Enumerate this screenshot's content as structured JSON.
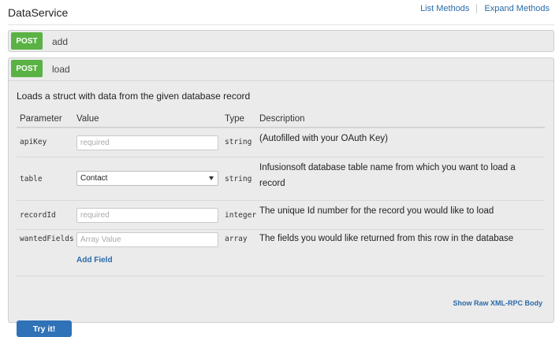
{
  "service": {
    "title": "DataService"
  },
  "links": {
    "list_methods": "List Methods",
    "expand_methods": "Expand Methods"
  },
  "operations": [
    {
      "verb": "POST",
      "path": "add"
    },
    {
      "verb": "POST",
      "path": "load",
      "description": "Loads a struct with data from the given database record",
      "headers": {
        "parameter": "Parameter",
        "value": "Value",
        "type": "Type",
        "description": "Description"
      },
      "params": [
        {
          "name": "apiKey",
          "placeholder": "required",
          "type": "string",
          "description": "(Autofilled with your OAuth Key)"
        },
        {
          "name": "table",
          "selected": "Contact",
          "type": "string",
          "description": "Infusionsoft database table name from which you want to load a record"
        },
        {
          "name": "recordId",
          "placeholder": "required",
          "type": "integer",
          "description": "The unique Id number for the record you would like to load"
        },
        {
          "name": "wantedFields",
          "placeholder": "Array Value",
          "type": "array",
          "description": "The fields you would like returned from this row in the database",
          "add_label": "Add Field"
        }
      ],
      "raw_link": "Show Raw XML-RPC Body",
      "try_label": "Try it!"
    }
  ]
}
